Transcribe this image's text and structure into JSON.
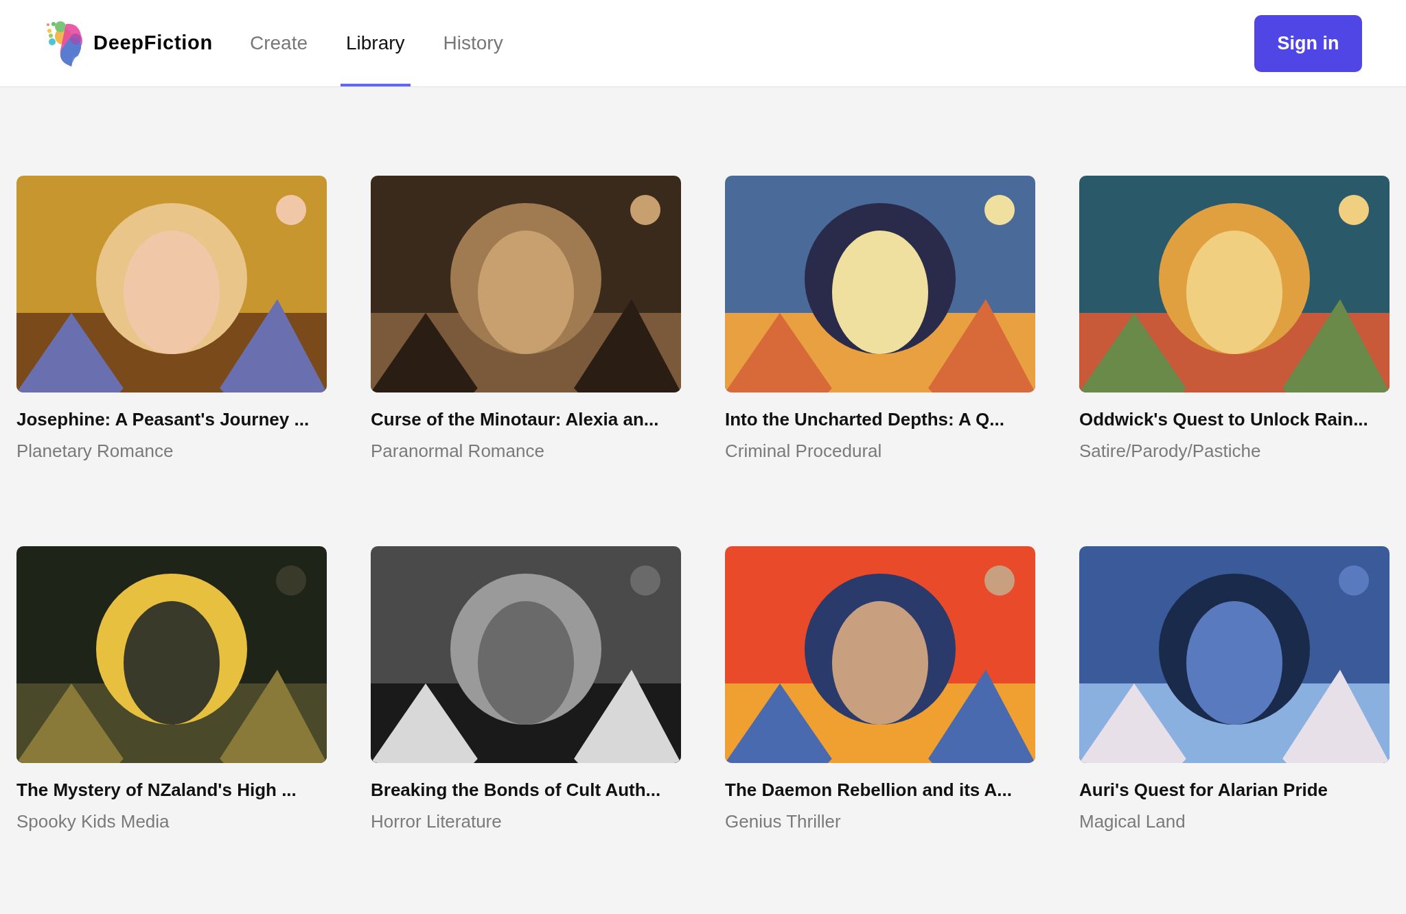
{
  "header": {
    "brand": "DeepFiction",
    "nav": [
      {
        "label": "Create",
        "selected": false
      },
      {
        "label": "Library",
        "selected": true
      },
      {
        "label": "History",
        "selected": false
      }
    ],
    "sign_in": "Sign in"
  },
  "stories": [
    {
      "title": "Josephine: A Peasant's Journey ...",
      "genre": "Planetary Romance"
    },
    {
      "title": "Curse of the Minotaur: Alexia an...",
      "genre": "Paranormal Romance"
    },
    {
      "title": "Into the Uncharted Depths: A Q...",
      "genre": "Criminal Procedural"
    },
    {
      "title": "Oddwick's Quest to Unlock Rain...",
      "genre": "Satire/Parody/Pastiche"
    },
    {
      "title": "The Mystery of NZaland's High ...",
      "genre": "Spooky Kids Media"
    },
    {
      "title": "Breaking the Bonds of Cult Auth...",
      "genre": "Horror Literature"
    },
    {
      "title": "The Daemon Rebellion and its A...",
      "genre": "Genius Thriller"
    },
    {
      "title": "Auri's Quest for Alarian Pride",
      "genre": "Magical Land"
    }
  ]
}
